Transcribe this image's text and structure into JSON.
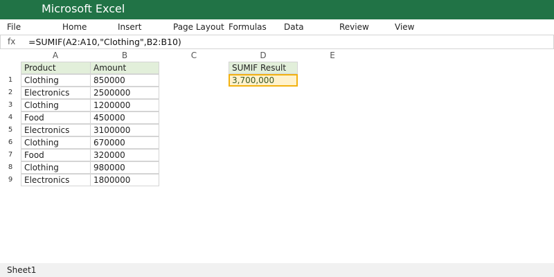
{
  "app": {
    "title": "Microsoft Excel"
  },
  "menu": [
    "File",
    "Home",
    "Insert",
    "Page Layout",
    "Formulas",
    "Data",
    "Review",
    "View"
  ],
  "formula_bar": {
    "fx_label": "fx",
    "formula": "=SUMIF(A2:A10,\"Clothing\",B2:B10)"
  },
  "columns": [
    "A",
    "B",
    "C",
    "D",
    "E"
  ],
  "rows": [
    "1",
    "2",
    "3",
    "4",
    "5",
    "6",
    "7",
    "8",
    "9"
  ],
  "table": {
    "headers": [
      "Product",
      "Amount"
    ],
    "data": [
      [
        "Clothing",
        "850000"
      ],
      [
        "Electronics",
        "2500000"
      ],
      [
        "Clothing",
        "1200000"
      ],
      [
        "Food",
        "450000"
      ],
      [
        "Electronics",
        "3100000"
      ],
      [
        "Clothing",
        "670000"
      ],
      [
        "Food",
        "320000"
      ],
      [
        "Clothing",
        "980000"
      ],
      [
        "Electronics",
        "1800000"
      ]
    ]
  },
  "result": {
    "label": "SUMIF Result",
    "value": "3,700,000"
  },
  "sheet": {
    "tab": "Sheet1"
  },
  "colors": {
    "brand": "#217346",
    "header_fill": "#e2efda",
    "result_fill": "#fff2cc",
    "result_border": "#f2b10f"
  }
}
